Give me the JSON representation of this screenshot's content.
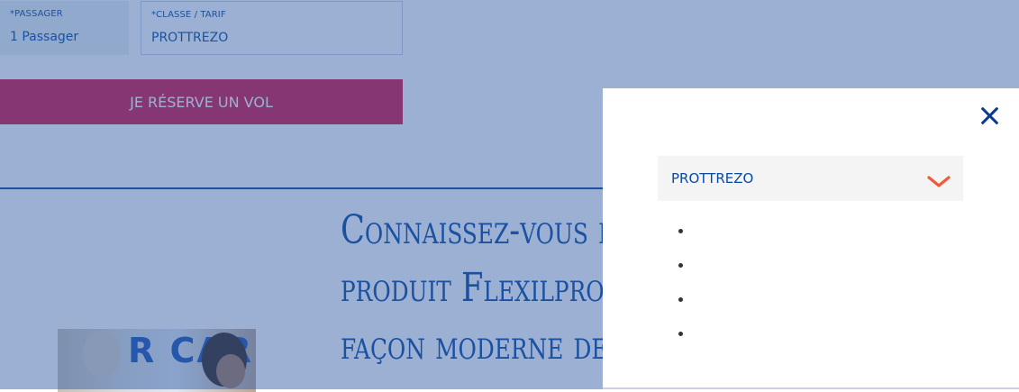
{
  "booking": {
    "passenger_label": "*PASSAGER",
    "passenger_value": "1 Passager",
    "class_label": "*CLASSE / TARIF",
    "class_value": "PROTTREZO",
    "book_button": "JE RÉSERVE UN VOL"
  },
  "promo": {
    "headline_lines": [
      "Connaissez-vous le",
      "produit Flexilpro, une",
      "façon moderne de"
    ],
    "photo_text": "R CAR"
  },
  "modal": {
    "selected_value": "PROTTREZO",
    "options": [
      "",
      "",
      "",
      ""
    ]
  },
  "colors": {
    "brand_blue": "#0a4aa0",
    "cta_red": "#d6184a",
    "chevron_orange": "#ef5a3c",
    "overlay": "rgba(45,90,160,0.48)"
  },
  "icons": {
    "close": "close-icon",
    "dropdown": "chevron-down-icon"
  }
}
